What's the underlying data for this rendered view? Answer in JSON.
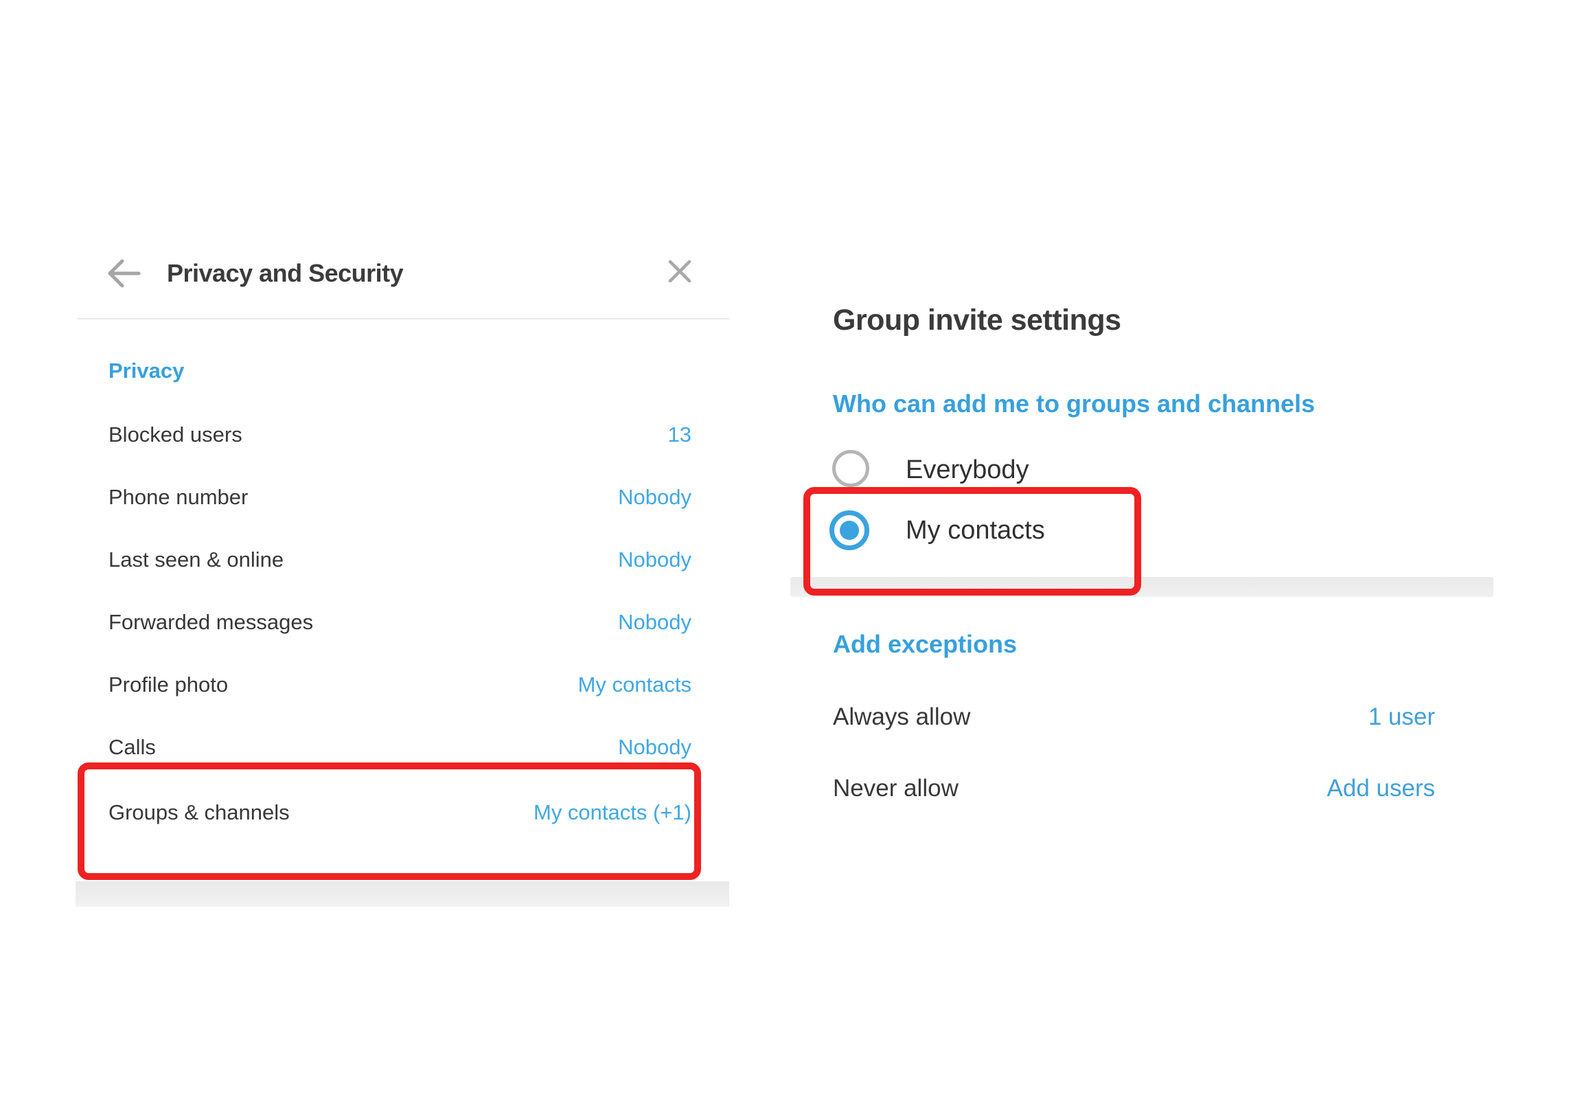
{
  "left_panel": {
    "title": "Privacy and Security",
    "icons": {
      "back": "arrow-left-icon",
      "close": "close-x-icon"
    },
    "section_heading": "Privacy",
    "rows": [
      {
        "label": "Blocked users",
        "value": "13",
        "highlighted": false
      },
      {
        "label": "Phone number",
        "value": "Nobody",
        "highlighted": false
      },
      {
        "label": "Last seen & online",
        "value": "Nobody",
        "highlighted": false
      },
      {
        "label": "Forwarded messages",
        "value": "Nobody",
        "highlighted": false
      },
      {
        "label": "Profile photo",
        "value": "My contacts",
        "highlighted": false
      },
      {
        "label": "Calls",
        "value": "Nobody",
        "highlighted": false
      },
      {
        "label": "Groups & channels",
        "value": "My contacts (+1)",
        "highlighted": true
      }
    ]
  },
  "right_panel": {
    "title": "Group invite settings",
    "question_heading": "Who can add me to groups and channels",
    "options": [
      {
        "label": "Everybody",
        "selected": false,
        "highlighted": false
      },
      {
        "label": "My contacts",
        "selected": true,
        "highlighted": true
      }
    ],
    "exceptions_heading": "Add exceptions",
    "exception_rows": [
      {
        "label": "Always allow",
        "value": "1 user"
      },
      {
        "label": "Never allow",
        "value": "Add users"
      }
    ]
  },
  "colors": {
    "link_blue": "#40a7e3",
    "heading_blue": "#37a0dd",
    "radio_blue": "#3aa3e0",
    "text_dark": "#383838",
    "annotation_red": "#ee2222",
    "icon_gray": "#a5a5a5",
    "divider_gray": "#e9e9e9",
    "section_bar_gray": "#ededed"
  }
}
